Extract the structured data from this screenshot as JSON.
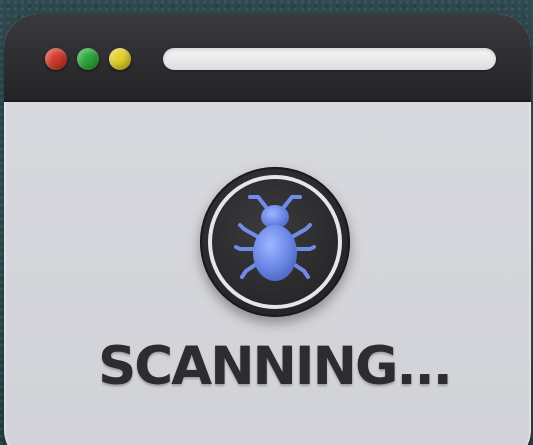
{
  "window": {
    "controls": [
      {
        "name": "close",
        "color": "#d13a2a"
      },
      {
        "name": "maximize",
        "color": "#2ea63b"
      },
      {
        "name": "minimize",
        "color": "#e3cf2a"
      }
    ],
    "address_bar": {
      "value": ""
    }
  },
  "main": {
    "icon": "bug-icon",
    "status_text": "SCANNING..."
  }
}
